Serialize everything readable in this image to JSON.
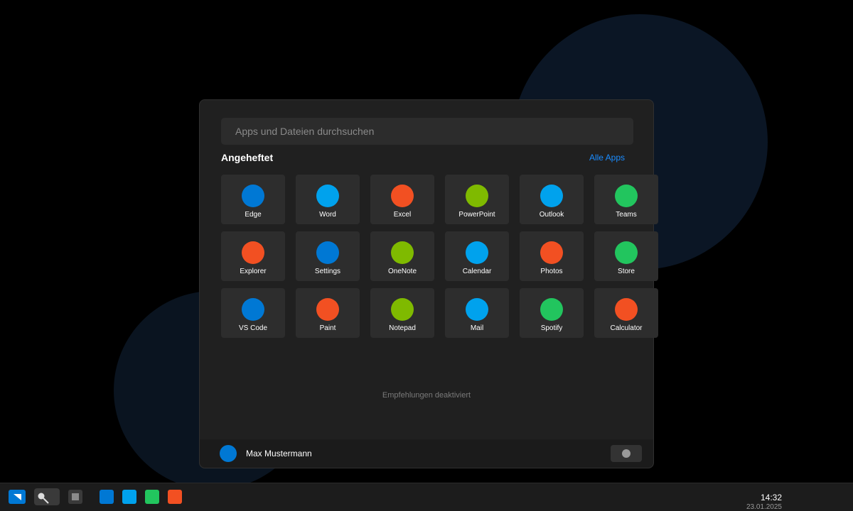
{
  "start_menu": {
    "search_placeholder": "Apps und Dateien durchsuchen",
    "pinned_title": "Angeheftet",
    "all_apps_label": "Alle Apps",
    "pinned_apps": [
      {
        "label": "Edge",
        "color": "#0078d4"
      },
      {
        "label": "Word",
        "color": "#00a2ed"
      },
      {
        "label": "Excel",
        "color": "#f25022"
      },
      {
        "label": "PowerPoint",
        "color": "#7fba00"
      },
      {
        "label": "Outlook",
        "color": "#00a2ed"
      },
      {
        "label": "Teams",
        "color": "#22c55e"
      },
      {
        "label": "Explorer",
        "color": "#f25022"
      },
      {
        "label": "Settings",
        "color": "#0078d4"
      },
      {
        "label": "OneNote",
        "color": "#7fba00"
      },
      {
        "label": "Calendar",
        "color": "#00a2ed"
      },
      {
        "label": "Photos",
        "color": "#f25022"
      },
      {
        "label": "Store",
        "color": "#22c55e"
      },
      {
        "label": "VS Code",
        "color": "#0078d4"
      },
      {
        "label": "Paint",
        "color": "#f25022"
      },
      {
        "label": "Notepad",
        "color": "#7fba00"
      },
      {
        "label": "Mail",
        "color": "#00a2ed"
      },
      {
        "label": "Spotify",
        "color": "#22c55e"
      },
      {
        "label": "Calculator",
        "color": "#f25022"
      }
    ],
    "recommendations_text": "Empfehlungen deaktiviert",
    "user_name": "Max Mustermann"
  },
  "taskbar": {
    "icons": {
      "start": "start-icon",
      "search": "search-icon",
      "task_view": "task-view-icon"
    },
    "pinned_apps": [
      {
        "color": "#0078d4"
      },
      {
        "color": "#00a2ed"
      },
      {
        "color": "#22c55e"
      },
      {
        "color": "#f25022"
      }
    ],
    "time": "14:32",
    "date": "23.01.2025"
  },
  "colors": {
    "accent": "#0078d4",
    "link": "#1a8cff",
    "menu_background": "#202020"
  }
}
